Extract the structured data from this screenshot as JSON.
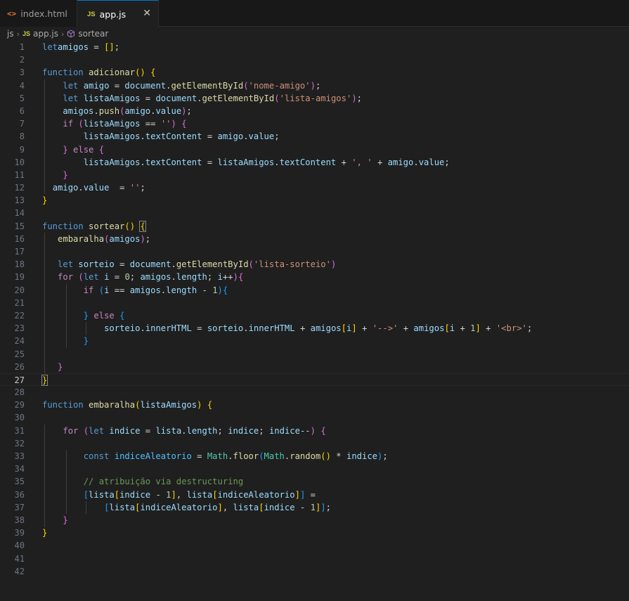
{
  "tabs": [
    {
      "label": "index.html",
      "icon": "html-file-icon",
      "active": false
    },
    {
      "label": "app.js",
      "icon": "js-file-icon",
      "active": true
    }
  ],
  "breadcrumb": {
    "folder": "js",
    "file": "app.js",
    "symbol": "sortear"
  },
  "editor": {
    "language": "javascript",
    "active_line": 27,
    "lines": [
      {
        "n": "1",
        "code": [
          [
            "kw",
            "let"
          ],
          [
            "",
            "amigos"
          ],
          [
            "op",
            " = "
          ],
          [
            "b1",
            "[]"
          ],
          [
            "op",
            ";"
          ]
        ]
      },
      {
        "n": "2",
        "code": []
      },
      {
        "n": "3",
        "code": [
          [
            "kw",
            "function"
          ],
          [
            "op",
            " "
          ],
          [
            "fn",
            "adicionar"
          ],
          [
            "b1",
            "()"
          ],
          [
            "op",
            " "
          ],
          [
            "b1",
            "{"
          ]
        ]
      },
      {
        "n": "4",
        "code": [
          [
            "op",
            "    "
          ],
          [
            "kw",
            "let"
          ],
          [
            "op",
            " "
          ],
          [
            "var",
            "amigo"
          ],
          [
            "op",
            " = "
          ],
          [
            "var",
            "document"
          ],
          [
            "op",
            "."
          ],
          [
            "fn",
            "getElementById"
          ],
          [
            "b2",
            "("
          ],
          [
            "str",
            "'nome-amigo'"
          ],
          [
            "b2",
            ")"
          ],
          [
            "op",
            ";"
          ]
        ]
      },
      {
        "n": "5",
        "code": [
          [
            "op",
            "    "
          ],
          [
            "kw",
            "let"
          ],
          [
            "op",
            " "
          ],
          [
            "var",
            "listaAmigos"
          ],
          [
            "op",
            " = "
          ],
          [
            "var",
            "document"
          ],
          [
            "op",
            "."
          ],
          [
            "fn",
            "getElementById"
          ],
          [
            "b2",
            "("
          ],
          [
            "str",
            "'lista-amigos'"
          ],
          [
            "b2",
            ")"
          ],
          [
            "op",
            ";"
          ]
        ]
      },
      {
        "n": "6",
        "code": [
          [
            "op",
            "    "
          ],
          [
            "var",
            "amigos"
          ],
          [
            "op",
            "."
          ],
          [
            "fn",
            "push"
          ],
          [
            "b2",
            "("
          ],
          [
            "var",
            "amigo"
          ],
          [
            "op",
            "."
          ],
          [
            "var",
            "value"
          ],
          [
            "b2",
            ")"
          ],
          [
            "op",
            ";"
          ]
        ]
      },
      {
        "n": "7",
        "code": [
          [
            "op",
            "    "
          ],
          [
            "ctrl",
            "if"
          ],
          [
            "op",
            " "
          ],
          [
            "b2",
            "("
          ],
          [
            "var",
            "listaAmigos"
          ],
          [
            "op",
            " == "
          ],
          [
            "str",
            "''"
          ],
          [
            "b2",
            ")"
          ],
          [
            "op",
            " "
          ],
          [
            "b2",
            "{"
          ]
        ]
      },
      {
        "n": "8",
        "code": [
          [
            "op",
            "        "
          ],
          [
            "var",
            "listaAmigos"
          ],
          [
            "op",
            "."
          ],
          [
            "var",
            "textContent"
          ],
          [
            "op",
            " = "
          ],
          [
            "var",
            "amigo"
          ],
          [
            "op",
            "."
          ],
          [
            "var",
            "value"
          ],
          [
            "op",
            ";"
          ]
        ]
      },
      {
        "n": "9",
        "code": [
          [
            "op",
            "    "
          ],
          [
            "b2",
            "}"
          ],
          [
            "op",
            " "
          ],
          [
            "ctrl",
            "else"
          ],
          [
            "op",
            " "
          ],
          [
            "b2",
            "{"
          ]
        ]
      },
      {
        "n": "10",
        "code": [
          [
            "op",
            "        "
          ],
          [
            "var",
            "listaAmigos"
          ],
          [
            "op",
            "."
          ],
          [
            "var",
            "textContent"
          ],
          [
            "op",
            " = "
          ],
          [
            "var",
            "listaAmigos"
          ],
          [
            "op",
            "."
          ],
          [
            "var",
            "textContent"
          ],
          [
            "op",
            " + "
          ],
          [
            "str",
            "', '"
          ],
          [
            "op",
            " + "
          ],
          [
            "var",
            "amigo"
          ],
          [
            "op",
            "."
          ],
          [
            "var",
            "value"
          ],
          [
            "op",
            ";"
          ]
        ]
      },
      {
        "n": "11",
        "code": [
          [
            "op",
            "    "
          ],
          [
            "b2",
            "}"
          ]
        ]
      },
      {
        "n": "12",
        "code": [
          [
            "op",
            "  "
          ],
          [
            "var",
            "amigo"
          ],
          [
            "op",
            "."
          ],
          [
            "var",
            "value"
          ],
          [
            "op",
            "  = "
          ],
          [
            "str",
            "''"
          ],
          [
            "op",
            ";"
          ]
        ]
      },
      {
        "n": "13",
        "code": [
          [
            "b1",
            "}"
          ]
        ]
      },
      {
        "n": "14",
        "code": []
      },
      {
        "n": "15",
        "code": [
          [
            "kw",
            "function"
          ],
          [
            "op",
            " "
          ],
          [
            "fn",
            "sortear"
          ],
          [
            "b1",
            "()"
          ],
          [
            "op",
            " "
          ],
          [
            "bm",
            "{"
          ]
        ]
      },
      {
        "n": "16",
        "code": [
          [
            "op",
            "   "
          ],
          [
            "fn",
            "embaralha"
          ],
          [
            "b2",
            "("
          ],
          [
            "var",
            "amigos"
          ],
          [
            "b2",
            ")"
          ],
          [
            "op",
            ";"
          ]
        ]
      },
      {
        "n": "17",
        "code": []
      },
      {
        "n": "18",
        "code": [
          [
            "op",
            "   "
          ],
          [
            "kw",
            "let"
          ],
          [
            "op",
            " "
          ],
          [
            "var",
            "sorteio"
          ],
          [
            "op",
            " = "
          ],
          [
            "var",
            "document"
          ],
          [
            "op",
            "."
          ],
          [
            "fn",
            "getElementById"
          ],
          [
            "b2",
            "("
          ],
          [
            "str",
            "'lista-sorteio'"
          ],
          [
            "b2",
            ")"
          ]
        ]
      },
      {
        "n": "19",
        "code": [
          [
            "op",
            "   "
          ],
          [
            "ctrl",
            "for"
          ],
          [
            "op",
            " "
          ],
          [
            "b2",
            "("
          ],
          [
            "kw",
            "let"
          ],
          [
            "op",
            " "
          ],
          [
            "var",
            "i"
          ],
          [
            "op",
            " = "
          ],
          [
            "num",
            "0"
          ],
          [
            "op",
            "; "
          ],
          [
            "var",
            "amigos"
          ],
          [
            "op",
            "."
          ],
          [
            "var",
            "length"
          ],
          [
            "op",
            "; "
          ],
          [
            "var",
            "i"
          ],
          [
            "op",
            "++"
          ],
          [
            "b2",
            ")"
          ],
          [
            "b2",
            "{"
          ]
        ]
      },
      {
        "n": "20",
        "code": [
          [
            "op",
            "        "
          ],
          [
            "ctrl",
            "if"
          ],
          [
            "op",
            " "
          ],
          [
            "b3",
            "("
          ],
          [
            "var",
            "i"
          ],
          [
            "op",
            " == "
          ],
          [
            "var",
            "amigos"
          ],
          [
            "op",
            "."
          ],
          [
            "var",
            "length"
          ],
          [
            "op",
            " - "
          ],
          [
            "num",
            "1"
          ],
          [
            "b3",
            ")"
          ],
          [
            "b3",
            "{"
          ]
        ]
      },
      {
        "n": "21",
        "code": []
      },
      {
        "n": "22",
        "code": [
          [
            "op",
            "        "
          ],
          [
            "b3",
            "}"
          ],
          [
            "op",
            " "
          ],
          [
            "ctrl",
            "else"
          ],
          [
            "op",
            " "
          ],
          [
            "b3",
            "{"
          ]
        ]
      },
      {
        "n": "23",
        "code": [
          [
            "op",
            "            "
          ],
          [
            "var",
            "sorteio"
          ],
          [
            "op",
            "."
          ],
          [
            "var",
            "innerHTML"
          ],
          [
            "op",
            " = "
          ],
          [
            "var",
            "sorteio"
          ],
          [
            "op",
            "."
          ],
          [
            "var",
            "innerHTML"
          ],
          [
            "op",
            " + "
          ],
          [
            "var",
            "amigos"
          ],
          [
            "b1",
            "["
          ],
          [
            "var",
            "i"
          ],
          [
            "b1",
            "]"
          ],
          [
            "op",
            " + "
          ],
          [
            "str",
            "'-->'"
          ],
          [
            "op",
            " + "
          ],
          [
            "var",
            "amigos"
          ],
          [
            "b1",
            "["
          ],
          [
            "var",
            "i"
          ],
          [
            "op",
            " + "
          ],
          [
            "num",
            "1"
          ],
          [
            "b1",
            "]"
          ],
          [
            "op",
            " + "
          ],
          [
            "str",
            "'<br>'"
          ],
          [
            "op",
            ";"
          ]
        ]
      },
      {
        "n": "24",
        "code": [
          [
            "op",
            "        "
          ],
          [
            "b3",
            "}"
          ]
        ]
      },
      {
        "n": "25",
        "code": []
      },
      {
        "n": "26",
        "code": [
          [
            "op",
            "   "
          ],
          [
            "b2",
            "}"
          ]
        ]
      },
      {
        "n": "27",
        "code": [
          [
            "bm",
            "}"
          ]
        ]
      },
      {
        "n": "28",
        "code": []
      },
      {
        "n": "29",
        "code": [
          [
            "kw",
            "function"
          ],
          [
            "op",
            " "
          ],
          [
            "fn",
            "embaralha"
          ],
          [
            "b1",
            "("
          ],
          [
            "var",
            "listaAmigos"
          ],
          [
            "b1",
            ")"
          ],
          [
            "op",
            " "
          ],
          [
            "b1",
            "{"
          ]
        ]
      },
      {
        "n": "30",
        "code": []
      },
      {
        "n": "31",
        "code": [
          [
            "op",
            "    "
          ],
          [
            "ctrl",
            "for"
          ],
          [
            "op",
            " "
          ],
          [
            "b2",
            "("
          ],
          [
            "kw",
            "let"
          ],
          [
            "op",
            " "
          ],
          [
            "var",
            "indice"
          ],
          [
            "op",
            " = "
          ],
          [
            "var",
            "lista"
          ],
          [
            "op",
            "."
          ],
          [
            "var",
            "length"
          ],
          [
            "op",
            "; "
          ],
          [
            "var",
            "indice"
          ],
          [
            "op",
            "; "
          ],
          [
            "var",
            "indice"
          ],
          [
            "op",
            "--"
          ],
          [
            "b2",
            ")"
          ],
          [
            "op",
            " "
          ],
          [
            "b2",
            "{"
          ]
        ]
      },
      {
        "n": "32",
        "code": []
      },
      {
        "n": "33",
        "code": [
          [
            "op",
            "        "
          ],
          [
            "kw",
            "const"
          ],
          [
            "op",
            " "
          ],
          [
            "const",
            "indiceAleatorio"
          ],
          [
            "op",
            " = "
          ],
          [
            "cls",
            "Math"
          ],
          [
            "op",
            "."
          ],
          [
            "fn",
            "floor"
          ],
          [
            "b3",
            "("
          ],
          [
            "cls",
            "Math"
          ],
          [
            "op",
            "."
          ],
          [
            "fn",
            "random"
          ],
          [
            "b1",
            "()"
          ],
          [
            "op",
            " * "
          ],
          [
            "var",
            "indice"
          ],
          [
            "b3",
            ")"
          ],
          [
            "op",
            ";"
          ]
        ]
      },
      {
        "n": "34",
        "code": []
      },
      {
        "n": "35",
        "code": [
          [
            "op",
            "        "
          ],
          [
            "com",
            "// atribuição via destructuring"
          ]
        ]
      },
      {
        "n": "36",
        "code": [
          [
            "op",
            "        "
          ],
          [
            "b3",
            "["
          ],
          [
            "var",
            "lista"
          ],
          [
            "b1",
            "["
          ],
          [
            "var",
            "indice"
          ],
          [
            "op",
            " - "
          ],
          [
            "num",
            "1"
          ],
          [
            "b1",
            "]"
          ],
          [
            "op",
            ", "
          ],
          [
            "var",
            "lista"
          ],
          [
            "b1",
            "["
          ],
          [
            "var",
            "indiceAleatorio"
          ],
          [
            "b1",
            "]"
          ],
          [
            "b3",
            "]"
          ],
          [
            "op",
            " ="
          ]
        ]
      },
      {
        "n": "37",
        "code": [
          [
            "op",
            "            "
          ],
          [
            "b3",
            "["
          ],
          [
            "var",
            "lista"
          ],
          [
            "b1",
            "["
          ],
          [
            "var",
            "indiceAleatorio"
          ],
          [
            "b1",
            "]"
          ],
          [
            "op",
            ", "
          ],
          [
            "var",
            "lista"
          ],
          [
            "b1",
            "["
          ],
          [
            "var",
            "indice"
          ],
          [
            "op",
            " - "
          ],
          [
            "num",
            "1"
          ],
          [
            "b1",
            "]"
          ],
          [
            "b3",
            "]"
          ],
          [
            "op",
            ";"
          ]
        ]
      },
      {
        "n": "38",
        "code": [
          [
            "op",
            "    "
          ],
          [
            "b2",
            "}"
          ]
        ]
      },
      {
        "n": "39",
        "code": [
          [
            "b1",
            "}"
          ]
        ]
      },
      {
        "n": "40",
        "code": []
      },
      {
        "n": "41",
        "code": []
      },
      {
        "n": "42",
        "code": []
      }
    ]
  },
  "colors": {
    "background": "#1f1f1f",
    "keyword": "#569cd6",
    "control": "#c586c0",
    "function": "#dcdcaa",
    "variable": "#9cdcfe",
    "string": "#ce9178",
    "number": "#b5cea8",
    "comment": "#6a9955",
    "accent": "#0078d4"
  }
}
